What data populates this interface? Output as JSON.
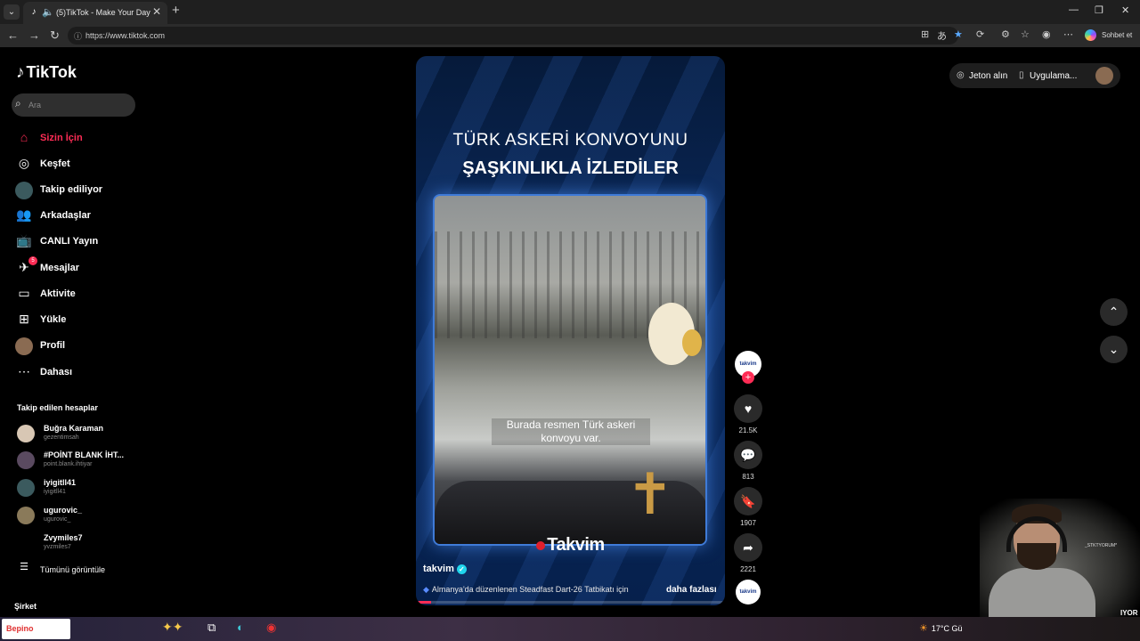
{
  "browser": {
    "tab_title": "(5)TikTok - Make Your Day",
    "url": "https://www.tiktok.com",
    "copilot_label": "Sohbet et"
  },
  "sidebar": {
    "logo": "TikTok",
    "search_placeholder": "Ara",
    "nav": [
      {
        "label": "Sizin İçin",
        "icon": "home-icon",
        "active": true
      },
      {
        "label": "Keşfet",
        "icon": "compass-icon"
      },
      {
        "label": "Takip ediliyor",
        "icon": "following-avatar-icon"
      },
      {
        "label": "Arkadaşlar",
        "icon": "friends-icon"
      },
      {
        "label": "CANLI Yayın",
        "icon": "live-tv-icon"
      },
      {
        "label": "Mesajlar",
        "icon": "messages-icon",
        "badge": "5"
      },
      {
        "label": "Aktivite",
        "icon": "activity-icon"
      },
      {
        "label": "Yükle",
        "icon": "upload-icon"
      },
      {
        "label": "Profil",
        "icon": "profile-avatar-icon"
      },
      {
        "label": "Dahası",
        "icon": "more-dots-icon"
      }
    ],
    "following_title": "Takip edilen hesaplar",
    "following": [
      {
        "name": "Buğra Karaman",
        "user": "gezentimsah"
      },
      {
        "name": "#POİNT BLANK İHT...",
        "user": "point.blank.ihtiyar"
      },
      {
        "name": "iyigitll41",
        "user": "iyigitll41"
      },
      {
        "name": "ugurovic_",
        "user": "ugurovic_"
      },
      {
        "name": "Zvymiles7",
        "user": "yvzmiles7"
      }
    ],
    "see_all": "Tümünü görüntüle",
    "company": "Şirket"
  },
  "video": {
    "headline_line1": "TÜRK ASKERİ KONVOYUNU",
    "headline_line2": "ŞAŞKINLIKLA İZLEDİLER",
    "subtitle": "Burada resmen Türk askeri konvoyu var.",
    "watermark": "Takvim",
    "author": "takvim",
    "caption": "Almanya'da düzenlenen Steadfast Dart-26 Tatbikatı için",
    "more": "daha fazlası",
    "progress": 0.05
  },
  "actions": {
    "avatar_text": "takvim",
    "likes": "21.5K",
    "comments": "813",
    "saves": "1907",
    "shares": "2221"
  },
  "topright": {
    "coins": "Jeton alın",
    "app": "Uygulama..."
  },
  "webcam": {
    "tag": "_STKTYORUM*",
    "overflow": "IYOR"
  },
  "taskbar": {
    "search_text": "Bepino",
    "weather": "17°C  Gü"
  }
}
